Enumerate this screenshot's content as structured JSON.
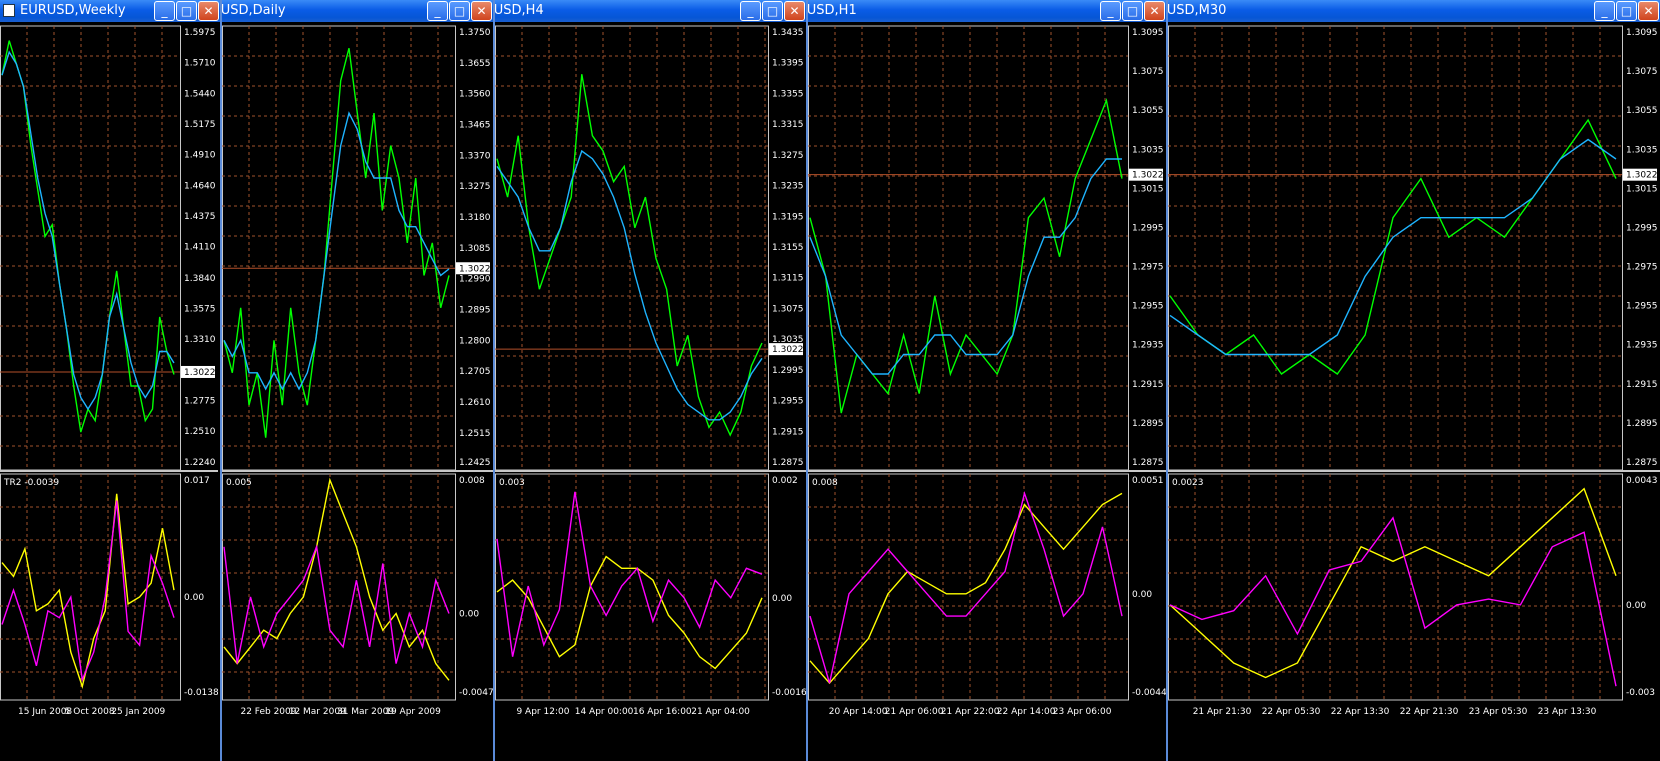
{
  "windows": [
    {
      "id": "weekly",
      "title": "EURUSD,Weekly",
      "price_labels": [
        "1.5975",
        "1.5710",
        "1.5440",
        "1.5175",
        "1.4910",
        "1.4640",
        "1.4375",
        "1.4110",
        "1.3840",
        "1.3575",
        "1.3310",
        "1.3022",
        "1.2775",
        "1.2510",
        "1.2240"
      ],
      "current_price": "1.3022",
      "ind_label": "TR2 -0.0039",
      "ind_labels": [
        "0.017",
        "0.00",
        "-0.0138"
      ],
      "time_labels": [
        "15 Jun 2008",
        "5 Oct 2008",
        "25 Jan 2009"
      ],
      "price_green": [
        1.56,
        1.59,
        1.57,
        1.55,
        1.5,
        1.46,
        1.42,
        1.43,
        1.38,
        1.34,
        1.29,
        1.25,
        1.27,
        1.26,
        1.3,
        1.35,
        1.39,
        1.34,
        1.29,
        1.29,
        1.26,
        1.27,
        1.35,
        1.32,
        1.3
      ],
      "price_blue": [
        1.56,
        1.58,
        1.57,
        1.55,
        1.51,
        1.47,
        1.44,
        1.42,
        1.38,
        1.34,
        1.3,
        1.28,
        1.27,
        1.28,
        1.3,
        1.35,
        1.37,
        1.34,
        1.31,
        1.29,
        1.28,
        1.29,
        1.32,
        1.32,
        1.31
      ],
      "ind_yellow": [
        0.005,
        0.003,
        0.007,
        -0.002,
        -0.001,
        0.001,
        -0.008,
        -0.013,
        -0.006,
        -0.002,
        0.015,
        -0.001,
        0.0,
        0.002,
        0.01,
        0.001
      ],
      "ind_magenta": [
        -0.004,
        0.001,
        -0.004,
        -0.01,
        -0.002,
        -0.003,
        0.0,
        -0.012,
        -0.008,
        0.0,
        0.014,
        -0.005,
        -0.007,
        0.006,
        0.002,
        -0.003
      ]
    },
    {
      "id": "daily",
      "title": "EURUSD,Daily",
      "price_labels": [
        "1.3750",
        "1.3655",
        "1.3560",
        "1.3465",
        "1.3370",
        "1.3275",
        "1.3180",
        "1.3085",
        "1.3022",
        "1.2990",
        "1.2895",
        "1.2800",
        "1.2705",
        "1.2610",
        "1.2515",
        "1.2425"
      ],
      "current_price": "1.3022",
      "ind_label": "0.005",
      "ind_labels": [
        "0.008",
        "0.00",
        "-0.0047"
      ],
      "time_labels": [
        "22 Feb 2009",
        "12 Mar 2009",
        "31 Mar 2009",
        "19 Apr 2009"
      ],
      "price_green": [
        1.28,
        1.27,
        1.29,
        1.26,
        1.27,
        1.25,
        1.28,
        1.26,
        1.29,
        1.27,
        1.26,
        1.28,
        1.3,
        1.33,
        1.36,
        1.37,
        1.35,
        1.33,
        1.35,
        1.32,
        1.34,
        1.33,
        1.31,
        1.33,
        1.3,
        1.31,
        1.29,
        1.3
      ],
      "price_blue": [
        1.28,
        1.275,
        1.28,
        1.27,
        1.27,
        1.265,
        1.27,
        1.265,
        1.27,
        1.265,
        1.27,
        1.28,
        1.3,
        1.32,
        1.34,
        1.35,
        1.345,
        1.335,
        1.33,
        1.33,
        1.33,
        1.32,
        1.315,
        1.315,
        1.31,
        1.305,
        1.3,
        1.302
      ],
      "ind_yellow": [
        -0.002,
        -0.003,
        -0.002,
        -0.001,
        -0.0015,
        0.0,
        0.001,
        0.004,
        0.008,
        0.006,
        0.004,
        0.001,
        -0.001,
        0.0,
        -0.002,
        -0.001,
        -0.003,
        -0.004
      ],
      "ind_magenta": [
        0.004,
        -0.003,
        0.001,
        -0.002,
        0.0,
        0.001,
        0.002,
        0.004,
        -0.001,
        -0.002,
        0.002,
        -0.002,
        0.003,
        -0.003,
        0.0,
        -0.002,
        0.002,
        0.0
      ]
    },
    {
      "id": "h4",
      "title": "EURUSD,H4",
      "price_labels": [
        "1.3435",
        "1.3395",
        "1.3355",
        "1.3315",
        "1.3275",
        "1.3235",
        "1.3195",
        "1.3155",
        "1.3115",
        "1.3075",
        "1.3035",
        "1.3022",
        "1.2995",
        "1.2955",
        "1.2915",
        "1.2875"
      ],
      "current_price": "1.3022",
      "ind_label": "0.003",
      "ind_labels": [
        "0.002",
        "0.00",
        "-0.0016"
      ],
      "time_labels": [
        "9 Apr 12:00",
        "14 Apr 00:00",
        "16 Apr 16:00",
        "21 Apr 04:00"
      ],
      "price_green": [
        1.327,
        1.322,
        1.33,
        1.318,
        1.31,
        1.314,
        1.318,
        1.322,
        1.338,
        1.33,
        1.328,
        1.324,
        1.326,
        1.318,
        1.322,
        1.314,
        1.31,
        1.3,
        1.304,
        1.296,
        1.292,
        1.294,
        1.291,
        1.294,
        1.3,
        1.303
      ],
      "price_blue": [
        1.326,
        1.324,
        1.322,
        1.318,
        1.315,
        1.315,
        1.318,
        1.324,
        1.328,
        1.327,
        1.325,
        1.322,
        1.318,
        1.312,
        1.307,
        1.303,
        1.3,
        1.297,
        1.295,
        1.294,
        1.293,
        1.293,
        1.294,
        1.296,
        1.299,
        1.301
      ],
      "ind_yellow": [
        0.0001,
        0.0003,
        0.0,
        -0.0005,
        -0.001,
        -0.0008,
        0.0002,
        0.0007,
        0.0005,
        0.0005,
        0.0003,
        -0.0003,
        -0.0006,
        -0.001,
        -0.0012,
        -0.0009,
        -0.0006,
        0.0
      ],
      "ind_magenta": [
        0.001,
        -0.001,
        0.0002,
        -0.0008,
        -0.0002,
        0.0018,
        0.0002,
        -0.0003,
        0.0002,
        0.0005,
        -0.0004,
        0.0003,
        0.0,
        -0.0005,
        0.0003,
        0.0,
        0.0005,
        0.0004
      ]
    },
    {
      "id": "h1",
      "title": "EURUSD,H1",
      "price_labels": [
        "1.3095",
        "1.3075",
        "1.3055",
        "1.3035",
        "1.3022",
        "1.3015",
        "1.2995",
        "1.2975",
        "1.2955",
        "1.2935",
        "1.2915",
        "1.2895",
        "1.2875"
      ],
      "current_price": "1.3022",
      "ind_label": "0.008",
      "ind_labels": [
        "0.0051",
        "0.00",
        "-0.0044"
      ],
      "time_labels": [
        "20 Apr 14:00",
        "21 Apr 06:00",
        "21 Apr 22:00",
        "22 Apr 14:00",
        "23 Apr 06:00"
      ],
      "price_green": [
        1.3,
        1.297,
        1.29,
        1.293,
        1.292,
        1.291,
        1.294,
        1.291,
        1.296,
        1.292,
        1.294,
        1.293,
        1.292,
        1.294,
        1.3,
        1.301,
        1.298,
        1.302,
        1.304,
        1.306,
        1.302
      ],
      "price_blue": [
        1.299,
        1.297,
        1.294,
        1.293,
        1.292,
        1.292,
        1.293,
        1.293,
        1.294,
        1.294,
        1.293,
        1.293,
        1.293,
        1.294,
        1.297,
        1.299,
        1.299,
        1.3,
        1.302,
        1.303,
        1.303
      ],
      "ind_yellow": [
        -0.003,
        -0.004,
        -0.003,
        -0.002,
        0.0,
        0.001,
        0.0005,
        0.0,
        0.0,
        0.0005,
        0.002,
        0.004,
        0.003,
        0.002,
        0.003,
        0.004,
        0.0045
      ],
      "ind_magenta": [
        -0.001,
        -0.004,
        0.0,
        0.001,
        0.002,
        0.001,
        0.0,
        -0.001,
        -0.001,
        0.0,
        0.001,
        0.0045,
        0.002,
        -0.001,
        0.0,
        0.003,
        -0.001
      ]
    },
    {
      "id": "m30",
      "title": "EURUSD,M30",
      "price_labels": [
        "1.3095",
        "1.3075",
        "1.3055",
        "1.3035",
        "1.3022",
        "1.3015",
        "1.2995",
        "1.2975",
        "1.2955",
        "1.2935",
        "1.2915",
        "1.2895",
        "1.2875"
      ],
      "current_price": "1.3022",
      "ind_label": "0.0023",
      "ind_labels": [
        "0.0043",
        "0.00",
        "-0.003"
      ],
      "time_labels": [
        "21 Apr 21:30",
        "22 Apr 05:30",
        "22 Apr 13:30",
        "22 Apr 21:30",
        "23 Apr 05:30",
        "23 Apr 13:30"
      ],
      "price_green": [
        1.296,
        1.294,
        1.293,
        1.294,
        1.292,
        1.293,
        1.292,
        1.294,
        1.3,
        1.302,
        1.299,
        1.3,
        1.299,
        1.301,
        1.303,
        1.305,
        1.302
      ],
      "price_blue": [
        1.295,
        1.294,
        1.293,
        1.293,
        1.293,
        1.293,
        1.294,
        1.297,
        1.299,
        1.3,
        1.3,
        1.3,
        1.3,
        1.301,
        1.303,
        1.304,
        1.303
      ],
      "ind_yellow": [
        0.0,
        -0.001,
        -0.002,
        -0.0025,
        -0.002,
        0.0,
        0.002,
        0.0015,
        0.002,
        0.0015,
        0.001,
        0.002,
        0.003,
        0.004,
        0.001
      ],
      "ind_magenta": [
        0.0,
        -0.0005,
        -0.0002,
        0.001,
        -0.001,
        0.0012,
        0.0015,
        0.003,
        -0.0008,
        0.0,
        0.0002,
        0.0,
        0.002,
        0.0025,
        -0.0028
      ]
    }
  ],
  "colors": {
    "green": "#00ff00",
    "blue": "#1eb4ff",
    "yellow": "#ffff00",
    "magenta": "#ff00ff",
    "grid": "#a0522d",
    "hline": "#b4502a",
    "text": "#ffffff"
  },
  "icons": {
    "minimize": "minimize-icon",
    "maximize": "maximize-icon",
    "close": "close-icon"
  }
}
